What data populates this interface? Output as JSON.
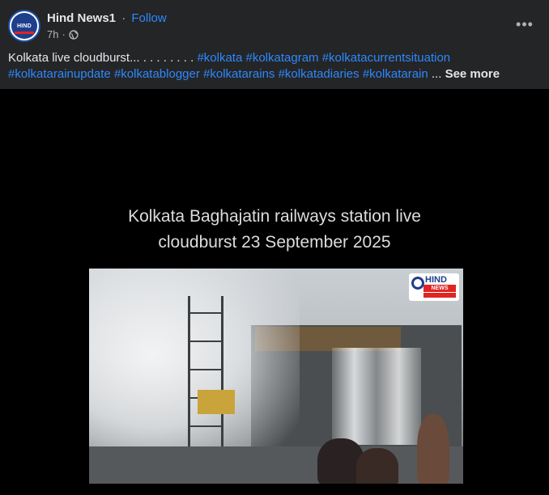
{
  "post": {
    "author": "Hind News1",
    "separator": "·",
    "follow_label": "Follow",
    "time": "7h",
    "privacy_icon": "globe-icon",
    "more_icon": "more-horizontal-icon",
    "more_label": "•••",
    "avatar_text": "HIND"
  },
  "caption": {
    "text": "Kolkata live cloudburst... . . . . . . . . ",
    "hashtags": [
      "#kolkata",
      "#kolkatagram",
      "#kolkatacurrentsituation",
      "#kolkatarainupdate",
      "#kolkatablogger",
      "#kolkatarains",
      "#kolkatadiaries",
      "#kolkatarain"
    ],
    "ellipsis": "...",
    "see_more_label": "See more"
  },
  "video": {
    "overlay_title_line1": "Kolkata Baghajatin railways station live",
    "overlay_title_line2": "cloudburst 23 September 2025",
    "watermark_brand": "HIND",
    "watermark_sub": "NEWS"
  },
  "colors": {
    "background": "#242526",
    "link_blue": "#2d88ff",
    "text_primary": "#e4e6eb",
    "text_secondary": "#b0b3b8",
    "video_bg": "#000000",
    "brand_blue": "#1d3f8c",
    "brand_red": "#e02424"
  }
}
